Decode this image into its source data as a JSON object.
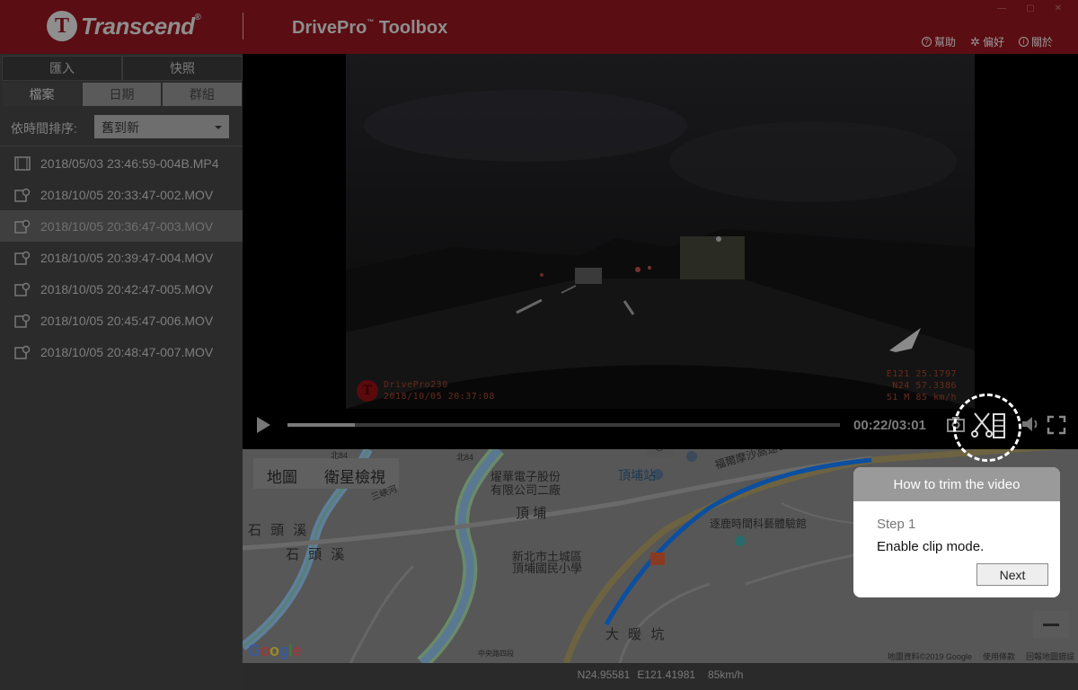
{
  "header": {
    "logo_mark": "T",
    "brand": "Transcend",
    "brand_reg": "®",
    "app_title": "DrivePro",
    "app_title_tm": "™",
    "app_title_suffix": " Toolbox",
    "menu": [
      {
        "icon": "help-icon",
        "label": "幫助"
      },
      {
        "icon": "gear-icon",
        "label": "偏好"
      },
      {
        "icon": "info-icon",
        "label": "關於"
      }
    ]
  },
  "sidebar": {
    "tabs": [
      "匯入",
      "快照"
    ],
    "subtabs": [
      "檔案",
      "日期",
      "群組"
    ],
    "active_subtab": "檔案",
    "sort_label": "依時間排序:",
    "sort_value": "舊到新",
    "files": [
      {
        "name": "2018/05/03 23:46:59-004B.MP4",
        "icon": "video-file-icon"
      },
      {
        "name": "2018/10/05 20:33:47-002.MOV",
        "icon": "video-gps-icon"
      },
      {
        "name": "2018/10/05 20:36:47-003.MOV",
        "icon": "video-gps-icon",
        "selected": true
      },
      {
        "name": "2018/10/05 20:39:47-004.MOV",
        "icon": "video-gps-icon"
      },
      {
        "name": "2018/10/05 20:42:47-005.MOV",
        "icon": "video-gps-icon"
      },
      {
        "name": "2018/10/05 20:45:47-006.MOV",
        "icon": "video-gps-icon"
      },
      {
        "name": "2018/10/05 20:48:47-007.MOV",
        "icon": "video-gps-icon"
      }
    ]
  },
  "video": {
    "overlay_logo_mark": "T",
    "overlay_model": "DrivePro230",
    "overlay_datetime": "2018/10/05 20:37:08",
    "overlay_lon": "E121 25.1797",
    "overlay_lat": "N24 57.3386",
    "overlay_alt_speed": "51 M   85 km/h",
    "time": "00:22/03:01",
    "progress_fraction": 0.1215
  },
  "map": {
    "tabs": [
      "地圖",
      "衛星檢視"
    ],
    "labels": [
      {
        "text": "北84"
      },
      {
        "text": "北84"
      },
      {
        "text": "燿華電子股份"
      },
      {
        "text": "有限公司二廠"
      },
      {
        "text": "頂埔站"
      },
      {
        "text": "頂 埔"
      },
      {
        "text": "福爾摩沙高速公路"
      },
      {
        "text": "石 頭 溪"
      },
      {
        "text": "石 頭 溪"
      },
      {
        "text": "新北市土城區"
      },
      {
        "text": "頂埔國民小學"
      },
      {
        "text": "逐鹿時間科藝體驗館"
      },
      {
        "text": "大 暖 坑"
      },
      {
        "text": "建"
      },
      {
        "text": "三峽河"
      },
      {
        "text": "中央路四段"
      }
    ],
    "google": [
      "G",
      "o",
      "o",
      "g",
      "l",
      "e"
    ],
    "footer": [
      "地圖資料©2019 Google",
      "使用條款",
      "回報地圖錯誤"
    ]
  },
  "status": {
    "lat": "N24.95581",
    "lon": "E121.41981",
    "speed": "85km/h"
  },
  "tutorial": {
    "title": "How to trim the video",
    "step": "Step 1",
    "description": "Enable clip mode.",
    "next_label": "Next"
  },
  "colors": {
    "header_bg": "#5a0d12",
    "route": "#0b4fa0",
    "highlight_ring": "#ffffff"
  }
}
